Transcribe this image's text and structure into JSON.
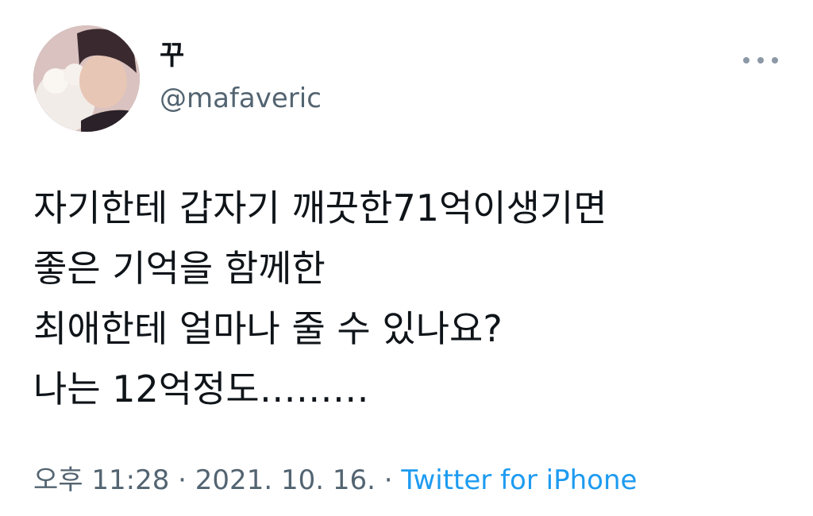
{
  "user": {
    "display_name": "꾸",
    "handle": "@mafaveric"
  },
  "tweet": {
    "lines": [
      "자기한테 갑자기 깨끗한71억이생기면",
      "좋은 기억을 함께한",
      "최애한테 얼마나 줄 수 있나요?",
      "나는 12억정도………"
    ]
  },
  "meta": {
    "time": "오후 11:28",
    "separator_1": " · ",
    "date": "2021. 10. 16.",
    "separator_2": " · ",
    "source": "Twitter for iPhone"
  },
  "colors": {
    "text_primary": "#0f1419",
    "text_secondary": "#536471",
    "link": "#1d9bf0"
  },
  "icons": {
    "more": "more-horizontal-icon"
  }
}
